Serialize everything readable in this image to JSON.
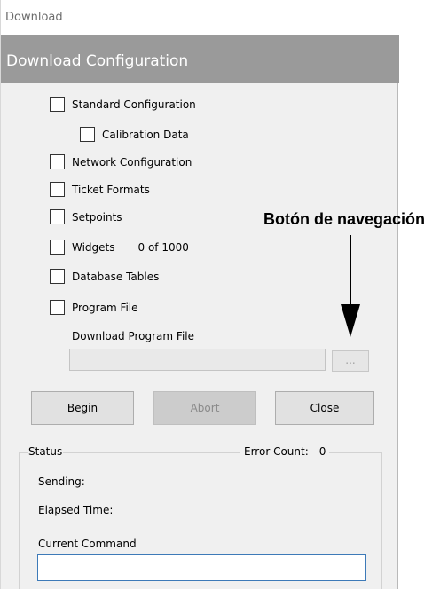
{
  "window": {
    "title": "Download",
    "header": "Download Configuration"
  },
  "options": {
    "standard_configuration": {
      "label": "Standard Configuration",
      "checked": false
    },
    "calibration_data": {
      "label": "Calibration Data",
      "checked": false
    },
    "network_configuration": {
      "label": "Network Configuration",
      "checked": false
    },
    "ticket_formats": {
      "label": "Ticket Formats",
      "checked": false
    },
    "setpoints": {
      "label": "Setpoints",
      "checked": false
    },
    "widgets": {
      "label": "Widgets",
      "count": "0 of 1000",
      "checked": false
    },
    "database_tables": {
      "label": "Database Tables",
      "checked": false
    },
    "program_file": {
      "label": "Program File",
      "checked": false
    }
  },
  "download_program_file": {
    "label": "Download Program File",
    "value": "",
    "browse_label": "..."
  },
  "buttons": {
    "begin": "Begin",
    "abort": "Abort",
    "close": "Close"
  },
  "status": {
    "legend": "Status",
    "error_count_label": "Error Count:",
    "error_count": "0",
    "sending_label": "Sending:",
    "elapsed_label": "Elapsed Time:",
    "current_command_label": "Current Command",
    "current_command_value": ""
  },
  "annotation": {
    "text": "Botón de navegación",
    "icon": "arrow-down-icon"
  },
  "colors": {
    "header_band": "#9a9a9a",
    "window_bg": "#f0f0f0",
    "focus_border": "#3d7ab8"
  }
}
